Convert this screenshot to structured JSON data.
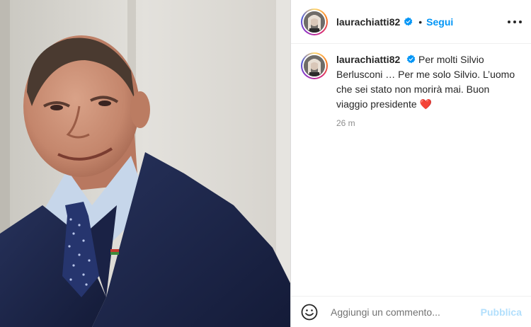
{
  "header": {
    "username": "laurachiatti82",
    "separator": "•",
    "follow_label": "Segui"
  },
  "caption": {
    "username": "laurachiatti82",
    "text": "Per molti Silvio Berlusconi … Per me solo Silvio. L’uomo che sei stato non morirà mai. Buon viaggio presidente",
    "emoji": "❤️",
    "time": "26 m"
  },
  "comment": {
    "placeholder": "Aggiungi un commento...",
    "publish_label": "Pubblica"
  },
  "colors": {
    "accent": "#0095f6",
    "verified": "#0095f6",
    "publish_disabled": "#b2dffc",
    "suit": "#1d2748"
  },
  "icons": [
    "verified-badge-icon",
    "more-options-icon",
    "emoji-icon"
  ]
}
